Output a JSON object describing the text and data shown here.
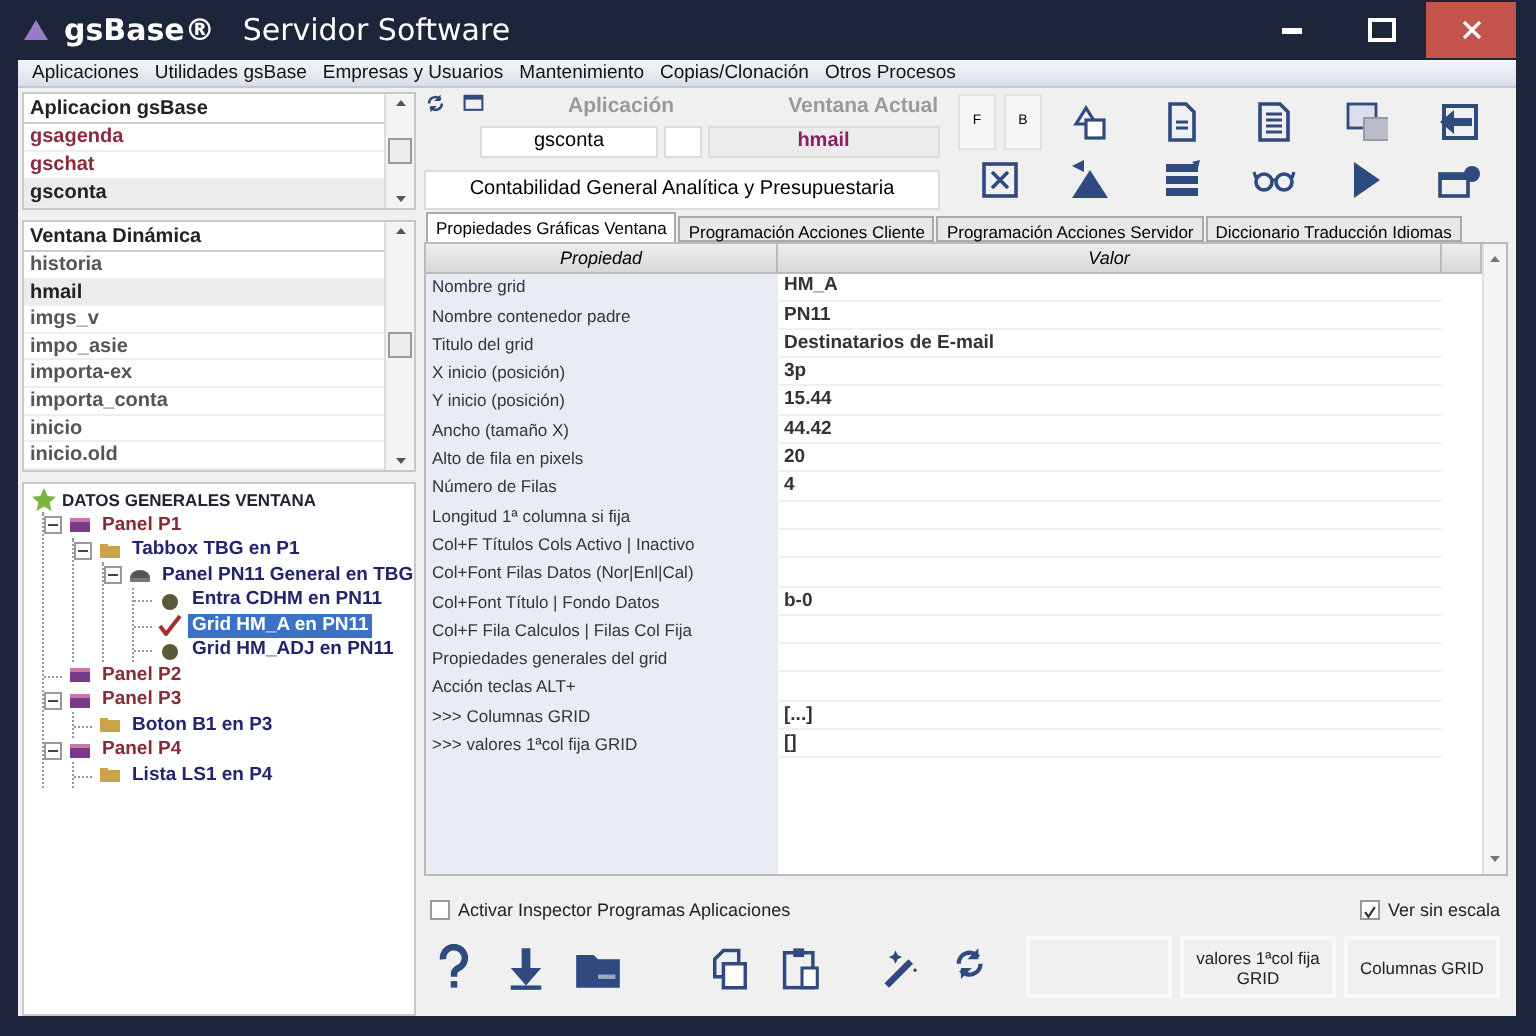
{
  "window": {
    "title": "gsBase®",
    "subtitle": "Servidor Software"
  },
  "menu": [
    "Aplicaciones",
    "Utilidades gsBase",
    "Empresas y Usuarios",
    "Mantenimiento",
    "Copias/Clonación",
    "Otros Procesos"
  ],
  "applications": {
    "header": "Aplicacion gsBase",
    "items": [
      {
        "label": "gsagenda",
        "selected": false
      },
      {
        "label": "gschat",
        "selected": false
      },
      {
        "label": "gsconta",
        "selected": true
      }
    ]
  },
  "dynamic_window": {
    "header": "Ventana Dinámica",
    "items": [
      {
        "label": "historia",
        "selected": false
      },
      {
        "label": "hmail",
        "selected": true
      },
      {
        "label": "imgs_v",
        "selected": false
      },
      {
        "label": "impo_asie",
        "selected": false
      },
      {
        "label": "importa-ex",
        "selected": false
      },
      {
        "label": "importa_conta",
        "selected": false
      },
      {
        "label": "inicio",
        "selected": false
      },
      {
        "label": "inicio.old",
        "selected": false
      }
    ]
  },
  "tree": {
    "label": "DATOS GENERALES VENTANA",
    "children": [
      {
        "label": "Panel P1",
        "kind": "panel",
        "selected": false,
        "expanded": true,
        "children": [
          {
            "label": "Tabbox TBG en P1",
            "kind": "folder",
            "selected": false,
            "expanded": true,
            "children": [
              {
                "label": "Panel PN11 General en TBG",
                "kind": "container",
                "selected": false,
                "expanded": true,
                "children": [
                  {
                    "label": "Entra CDHM en PN11",
                    "kind": "field",
                    "selected": false
                  },
                  {
                    "label": "Grid HM_A en PN11",
                    "kind": "grid",
                    "selected": true
                  },
                  {
                    "label": "Grid HM_ADJ en PN11",
                    "kind": "field",
                    "selected": false
                  }
                ]
              }
            ]
          }
        ]
      },
      {
        "label": "Panel P2",
        "kind": "panel",
        "selected": false
      },
      {
        "label": "Panel P3",
        "kind": "panel",
        "selected": false,
        "expanded": true,
        "children": [
          {
            "label": "Boton B1 en P3",
            "kind": "folder",
            "selected": false
          }
        ]
      },
      {
        "label": "Panel P4",
        "kind": "panel",
        "selected": false,
        "expanded": true,
        "children": [
          {
            "label": "Lista LS1 en P4",
            "kind": "folder",
            "selected": false
          }
        ]
      }
    ]
  },
  "app_panel": {
    "application_label": "Aplicación",
    "current_window_label": "Ventana Actual",
    "application": "gsconta",
    "current_window": "hmail",
    "description": "Contabilidad General Analítica y Presupuestaria"
  },
  "toolbar": {
    "text_buttons": [
      "F",
      "B"
    ]
  },
  "tabs": [
    {
      "label": "Propiedades Gráficas Ventana",
      "selected": true
    },
    {
      "label": "Programación Acciones Cliente",
      "selected": false
    },
    {
      "label": "Programación Acciones Servidor",
      "selected": false
    },
    {
      "label": "Diccionario Traducción Idiomas",
      "selected": false
    }
  ],
  "table": {
    "columns": [
      "Propiedad",
      "Valor"
    ],
    "rows": [
      {
        "property": "Nombre grid",
        "value": "HM_A"
      },
      {
        "property": "Nombre contenedor padre",
        "value": "PN11"
      },
      {
        "property": "Titulo del grid",
        "value": "Destinatarios de E-mail"
      },
      {
        "property": "X inicio (posición)",
        "value": "3p"
      },
      {
        "property": "Y inicio (posición)",
        "value": "15.44"
      },
      {
        "property": "Ancho (tamaño X)",
        "value": "44.42"
      },
      {
        "property": "Alto de fila en pixels",
        "value": "20"
      },
      {
        "property": "Número de Filas",
        "value": "4"
      },
      {
        "property": "Longitud 1ª columna si fija"
      },
      {
        "property": "Col+F Títulos Cols Activo | Inactivo"
      },
      {
        "property": "Col+Font Filas Datos (Nor|Enl|Cal)"
      },
      {
        "property": "Col+Font Título | Fondo Datos",
        "value": "b-0"
      },
      {
        "property": "Col+F Fila Calculos | Filas Col Fija"
      },
      {
        "property": "Propiedades generales del grid"
      },
      {
        "property": "Acción teclas ALT+"
      },
      {
        "property": ">>> Columnas GRID",
        "value": "[...]"
      },
      {
        "property": ">>> valores 1ªcol fija GRID",
        "value": "[]"
      }
    ]
  },
  "checkboxes": [
    {
      "label": "Activar Inspector Programas Aplicaciones",
      "checked": false
    },
    {
      "label": "Ver sin escala",
      "checked": true
    }
  ],
  "buttons": [
    "valores 1ªcol fija GRID",
    "Columnas GRID"
  ]
}
